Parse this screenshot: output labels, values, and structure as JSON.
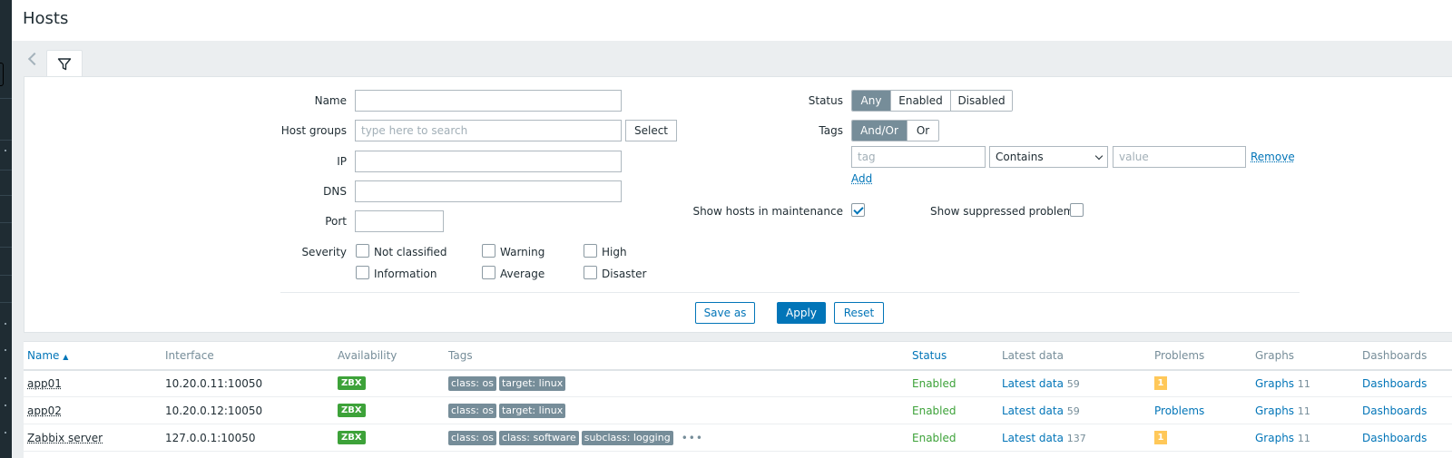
{
  "page": {
    "title": "Hosts"
  },
  "filter": {
    "name_label": "Name",
    "name_value": "",
    "host_groups_label": "Host groups",
    "host_groups_placeholder": "type here to search",
    "select_button": "Select",
    "ip_label": "IP",
    "ip_value": "",
    "dns_label": "DNS",
    "dns_value": "",
    "port_label": "Port",
    "port_value": "",
    "severity_label": "Severity",
    "severities": [
      {
        "label": "Not classified",
        "checked": false
      },
      {
        "label": "Warning",
        "checked": false
      },
      {
        "label": "High",
        "checked": false
      },
      {
        "label": "Information",
        "checked": false
      },
      {
        "label": "Average",
        "checked": false
      },
      {
        "label": "Disaster",
        "checked": false
      }
    ],
    "status_label": "Status",
    "status_options": [
      "Any",
      "Enabled",
      "Disabled"
    ],
    "status_selected": "Any",
    "tags_label": "Tags",
    "tags_options": [
      "And/Or",
      "Or"
    ],
    "tags_selected": "And/Or",
    "tag_placeholder": "tag",
    "tag_operator": "Contains",
    "value_placeholder": "value",
    "remove_link": "Remove",
    "add_link": "Add",
    "show_maintenance_label": "Show hosts in maintenance",
    "show_maintenance_checked": true,
    "show_suppressed_label": "Show suppressed problems",
    "show_suppressed_checked": false,
    "save_as_button": "Save as",
    "apply_button": "Apply",
    "reset_button": "Reset"
  },
  "table": {
    "columns": {
      "name": "Name",
      "sort_indicator": "▲",
      "interface": "Interface",
      "availability": "Availability",
      "tags": "Tags",
      "status": "Status",
      "latest_data": "Latest data",
      "problems": "Problems",
      "graphs": "Graphs",
      "dashboards": "Dashboards"
    },
    "rows": [
      {
        "name": "app01",
        "interface": "10.20.0.11:10050",
        "availability": "ZBX",
        "tags": [
          "class: os",
          "target: linux"
        ],
        "more_tags": false,
        "status": "Enabled",
        "latest_data": "Latest data",
        "latest_data_count": "59",
        "problems_badge": "1",
        "problems_text": "",
        "graphs": "Graphs",
        "graphs_count": "11",
        "dashboards": "Dashboards"
      },
      {
        "name": "app02",
        "interface": "10.20.0.12:10050",
        "availability": "ZBX",
        "tags": [
          "class: os",
          "target: linux"
        ],
        "more_tags": false,
        "status": "Enabled",
        "latest_data": "Latest data",
        "latest_data_count": "59",
        "problems_badge": "",
        "problems_text": "Problems",
        "graphs": "Graphs",
        "graphs_count": "11",
        "dashboards": "Dashboards"
      },
      {
        "name": "Zabbix server",
        "interface": "127.0.0.1:10050",
        "availability": "ZBX",
        "tags": [
          "class: os",
          "class: software",
          "subclass: logging"
        ],
        "more_tags": true,
        "more_symbol": "•••",
        "status": "Enabled",
        "latest_data": "Latest data",
        "latest_data_count": "137",
        "problems_badge": "1",
        "problems_text": "",
        "graphs": "Graphs",
        "graphs_count": "11",
        "dashboards": "Dashboards"
      }
    ]
  },
  "colors": {
    "accent": "#0275b8",
    "enabled": "#3da239",
    "problem_badge": "#ffc859",
    "tag_bg": "#768d99",
    "sidebar": "#1f2c33"
  },
  "icons": {
    "filter_tab": "filter-icon",
    "prev": "chevron-left-icon",
    "select_caret": "chevron-down-icon",
    "checkbox_checked": "checkmark-icon"
  }
}
